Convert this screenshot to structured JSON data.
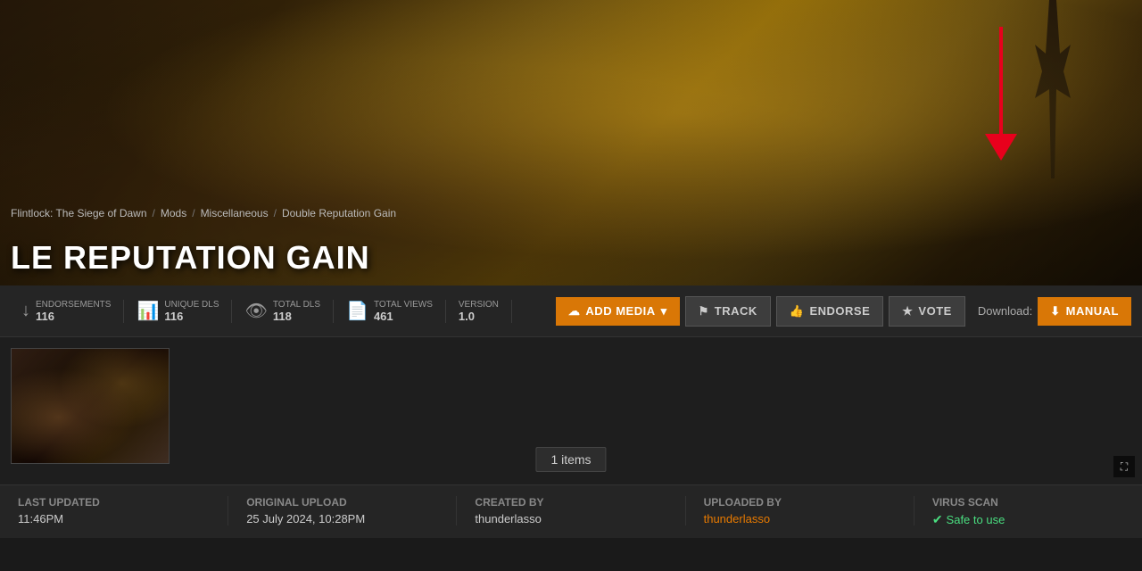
{
  "hero": {
    "title": "LE REPUTATION GAIN",
    "full_title": "DOUBLE REPUTATION GAIN"
  },
  "breadcrumb": {
    "game": "Flintlock: The Siege of Dawn",
    "section": "Mods",
    "category": "Miscellaneous",
    "current": "Double Reputation Gain",
    "sep": "/"
  },
  "stats": {
    "endorsements_label": "Endorsements",
    "endorsements_value": "116",
    "unique_dls_label": "Unique DLs",
    "unique_dls_value": "116",
    "total_dls_label": "Total DLs",
    "total_dls_value": "118",
    "total_views_label": "Total views",
    "total_views_value": "461",
    "version_label": "Version",
    "version_value": "1.0"
  },
  "buttons": {
    "add_media": "ADD MEDIA",
    "track": "TRACK",
    "endorse": "ENDORSE",
    "vote": "VOTE",
    "download_label": "Download:",
    "manual": "MANUAL"
  },
  "gallery": {
    "items_count": "1 items",
    "expand_icon": "⛶"
  },
  "footer": {
    "last_updated_label": "Last updated",
    "last_updated_value": "11:46PM",
    "original_upload_label": "Original upload",
    "original_upload_value": "25 July 2024, 10:28PM",
    "created_by_label": "Created by",
    "created_by_value": "thunderlasso",
    "uploaded_by_label": "Uploaded by",
    "uploaded_by_value": "thunderlasso",
    "virus_scan_label": "Virus scan",
    "virus_scan_value": "Safe to use"
  }
}
